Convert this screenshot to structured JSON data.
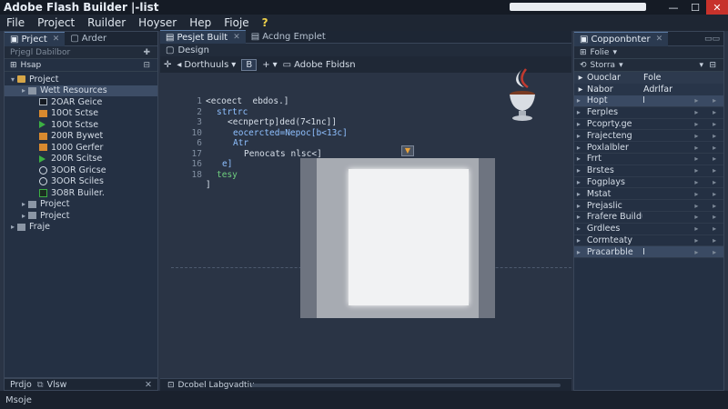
{
  "window": {
    "title": "Adobe Flash Builder  |-list"
  },
  "menu": {
    "items": [
      "File",
      "Project",
      "Ruilder",
      "Hoyser",
      "Hep",
      "Fioje"
    ],
    "help": "?"
  },
  "left": {
    "tabs": [
      {
        "label": "Prject"
      },
      {
        "label": "Arder"
      }
    ],
    "subtitle": "Prjegl Dabilbor",
    "root": "Hsap",
    "tree": [
      {
        "label": "Project",
        "icon": "folder",
        "indent": 0,
        "arrow": "down"
      },
      {
        "label": "Wett Resources",
        "icon": "folder-grey",
        "indent": 1,
        "arrow": "right",
        "selected": true
      },
      {
        "label": "2OAR Geice",
        "icon": "file-black",
        "indent": 2
      },
      {
        "label": "10Ot Sctse",
        "icon": "file-orange",
        "indent": 2
      },
      {
        "label": "10Ot Sctse",
        "icon": "play-green",
        "indent": 2
      },
      {
        "label": "200R Bywet",
        "icon": "file-orange",
        "indent": 2
      },
      {
        "label": "1000 Gerfer",
        "icon": "file-orange",
        "indent": 2
      },
      {
        "label": "200R Scitse",
        "icon": "play-green",
        "indent": 2
      },
      {
        "label": "3OOR Gricse",
        "icon": "circle",
        "indent": 2
      },
      {
        "label": "3OOR Sciles",
        "icon": "circle",
        "indent": 2
      },
      {
        "label": "3O8R Builer.",
        "icon": "box-green",
        "indent": 2
      },
      {
        "label": "Project",
        "icon": "folder-grey",
        "indent": 1,
        "arrow": "right"
      },
      {
        "label": "Project",
        "icon": "folder-grey",
        "indent": 1,
        "arrow": "right"
      },
      {
        "label": "Fraje",
        "icon": "file-grey",
        "indent": 0,
        "arrow": "right"
      }
    ],
    "bottom_tabs": [
      "Prdjo",
      "Vlsw"
    ]
  },
  "editor": {
    "tabs": [
      {
        "label": "Pesjet Built"
      },
      {
        "label": "Acdng Emplet"
      }
    ],
    "design_label": "Design",
    "toolbar": {
      "view": "Dorthuuls",
      "bold": "B",
      "plus": "+",
      "item": "Adobe Fbidsn"
    },
    "line_numbers": [
      "1",
      "2",
      "3",
      "10",
      "6",
      "17",
      "16",
      "18"
    ],
    "code": [
      {
        "text": "<ecoect  ebdos.]",
        "cls": "tx",
        "indent": 0
      },
      {
        "text": "strtrc",
        "cls": "kw",
        "indent": 2
      },
      {
        "text": "<ecnpertp]ded(7<1nc]]",
        "cls": "tx",
        "indent": 4
      },
      {
        "text": "eocercted=Nepoc[b<13c]",
        "cls": "kw",
        "indent": 5
      },
      {
        "text": "Atr",
        "cls": "kw",
        "indent": 5
      },
      {
        "text": "Penocats nlsc<]",
        "cls": "tx",
        "indent": 7
      },
      {
        "text": "e]",
        "cls": "kw",
        "indent": 3
      },
      {
        "text": "tesy",
        "cls": "gr",
        "indent": 2
      },
      {
        "text": "]",
        "cls": "tx",
        "indent": 0
      }
    ],
    "bottom_label": "Dcobel Labgvadtiu"
  },
  "right": {
    "tab": "Copponbnter",
    "subtitle": "Folie",
    "filter": "Storra",
    "header1": {
      "c1": "Ouoclar",
      "c2": "Fole"
    },
    "header2": {
      "c1": "Nabor",
      "c2": "Adrlfar"
    },
    "rows": [
      {
        "label": "Hopt",
        "val": "I",
        "selected": true
      },
      {
        "label": "Ferples",
        "val": ""
      },
      {
        "label": "Pcoprty.ge",
        "val": ""
      },
      {
        "label": "Frajecteng",
        "val": ""
      },
      {
        "label": "Poxlalbler",
        "val": ""
      },
      {
        "label": "Frrt",
        "val": ""
      },
      {
        "label": "Brstes",
        "val": ""
      },
      {
        "label": "Fogplays",
        "val": ""
      },
      {
        "label": "Mstat",
        "val": ""
      },
      {
        "label": "Prejaslic",
        "val": ""
      },
      {
        "label": "Frafere Buildur",
        "val": ""
      },
      {
        "label": "Grdlees",
        "val": ""
      },
      {
        "label": "Cormteaty",
        "val": ""
      },
      {
        "label": "Pracarbble",
        "val": "I",
        "selected": true
      }
    ]
  },
  "status": {
    "text": "Msoje"
  }
}
